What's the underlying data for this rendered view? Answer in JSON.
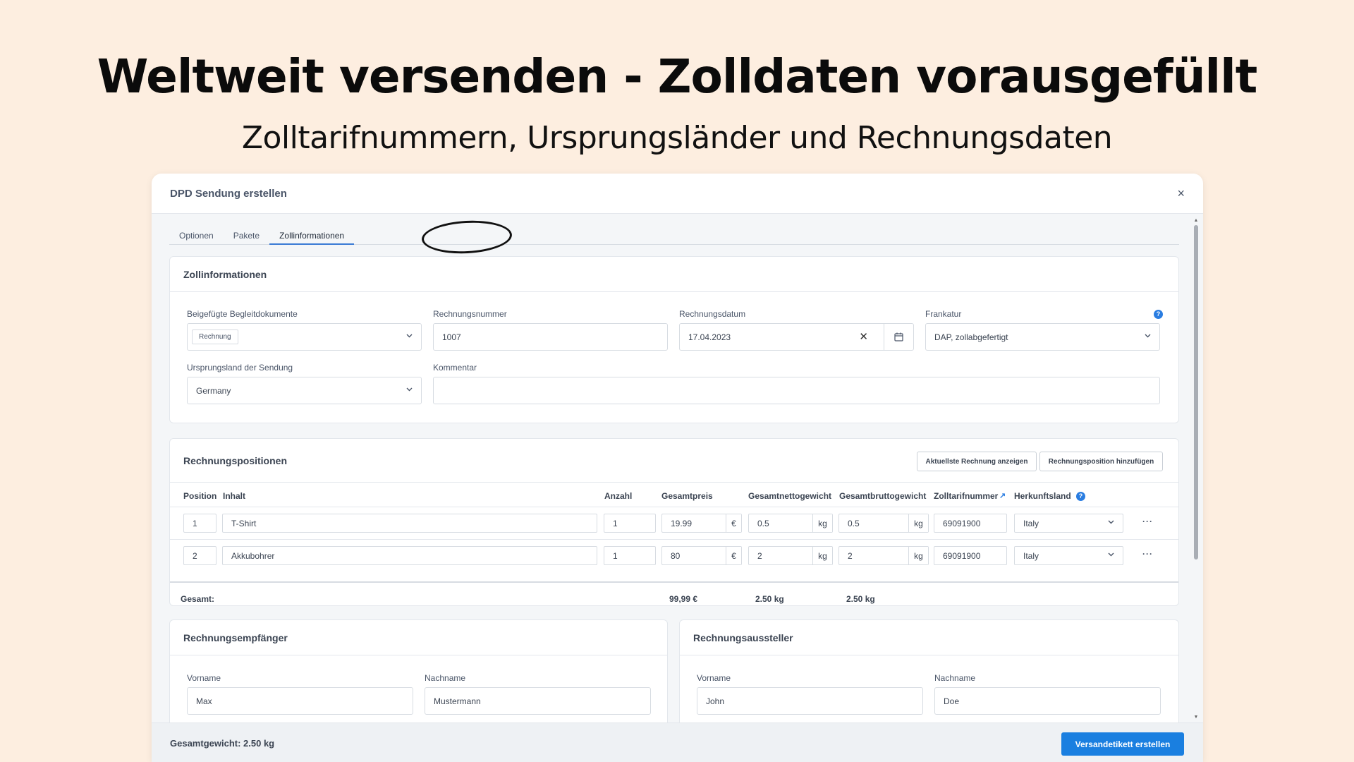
{
  "hero": {
    "title": "Weltweit versenden - Zolldaten vorausgefüllt",
    "subtitle": "Zolltarifnummern, Ursprungsländer und Rechnungsdaten"
  },
  "modal": {
    "title": "DPD Sendung erstellen",
    "close": "×",
    "tabs": [
      "Optionen",
      "Pakete",
      "Zollinformationen"
    ],
    "active_tab": "Zollinformationen"
  },
  "customs": {
    "title": "Zollinformationen",
    "docs_label": "Beigefügte Begleitdokumente",
    "docs_value": "Rechnung",
    "invoice_no_label": "Rechnungsnummer",
    "invoice_no_value": "1007",
    "invoice_date_label": "Rechnungsdatum",
    "invoice_date_value": "17.04.2023",
    "clear": "✕",
    "frankatur_label": "Frankatur",
    "frankatur_value": "DAP, zollabgefertigt",
    "origin_label": "Ursprungsland der Sendung",
    "origin_value": "Germany",
    "comment_label": "Kommentar",
    "comment_value": ""
  },
  "positions": {
    "title": "Rechnungspositionen",
    "btn_show_invoice": "Aktuellste Rechnung anzeigen",
    "btn_add_position": "Rechnungsposition hinzufügen",
    "columns": [
      "Position",
      "Inhalt",
      "Anzahl",
      "Gesamtpreis",
      "Gesamtnettogewicht",
      "Gesamtbruttogewicht",
      "Zolltarifnummer",
      "Herkunftsland"
    ],
    "rows": [
      {
        "position": "1",
        "content": "T-Shirt",
        "qty": "1",
        "price": "19.99",
        "price_unit": "€",
        "net": "0.5",
        "net_unit": "kg",
        "gross": "0.5",
        "gross_unit": "kg",
        "tariff": "69091900",
        "country": "Italy",
        "more": "···"
      },
      {
        "position": "2",
        "content": "Akkubohrer",
        "qty": "1",
        "price": "80",
        "price_unit": "€",
        "net": "2",
        "net_unit": "kg",
        "gross": "2",
        "gross_unit": "kg",
        "tariff": "69091900",
        "country": "Italy",
        "more": "···"
      }
    ],
    "total_label": "Gesamt:",
    "total_price": "99,99 €",
    "total_net": "2.50 kg",
    "total_gross": "2.50 kg"
  },
  "recipient": {
    "title": "Rechnungsempfänger",
    "first_label": "Vorname",
    "first_value": "Max",
    "last_label": "Nachname",
    "last_value": "Mustermann"
  },
  "issuer": {
    "title": "Rechnungsaussteller",
    "first_label": "Vorname",
    "first_value": "John",
    "last_label": "Nachname",
    "last_value": "Doe"
  },
  "footer": {
    "total_weight": "Gesamtgewicht: 2.50 kg",
    "submit": "Versandetikett erstellen"
  },
  "icons": {
    "help": "?",
    "chevron": "⌄",
    "external_link": "↗"
  },
  "colors": {
    "background": "#fdeee0",
    "primary": "#1a7fe0",
    "help_icon": "#2a7de1"
  }
}
